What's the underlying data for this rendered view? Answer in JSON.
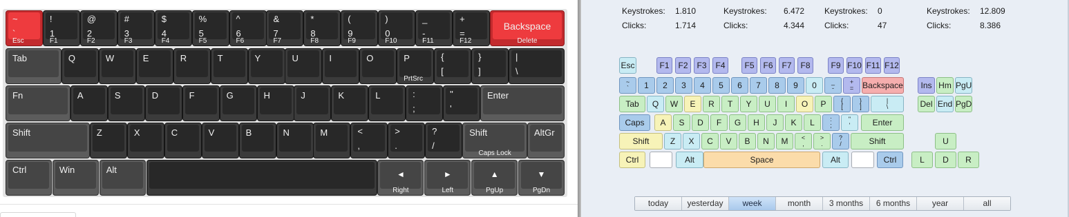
{
  "keyboard": {
    "keys": [
      {
        "id": "esc",
        "shape": "red",
        "top": "~",
        "bottom": "`",
        "fn": "Esc"
      },
      {
        "id": "1",
        "top": "!",
        "bottom": "1",
        "fn": "F1"
      },
      {
        "id": "2",
        "top": "@",
        "bottom": "2",
        "fn": "F2"
      },
      {
        "id": "3",
        "top": "#",
        "bottom": "3",
        "fn": "F3"
      },
      {
        "id": "4",
        "top": "$",
        "bottom": "4",
        "fn": "F4"
      },
      {
        "id": "5",
        "top": "%",
        "bottom": "5",
        "fn": "F5"
      },
      {
        "id": "6",
        "top": "^",
        "bottom": "6",
        "fn": "F6"
      },
      {
        "id": "7",
        "top": "&",
        "bottom": "7",
        "fn": "F7"
      },
      {
        "id": "8",
        "top": "*",
        "bottom": "8",
        "fn": "F8"
      },
      {
        "id": "9",
        "top": "(",
        "bottom": "9",
        "fn": "F9"
      },
      {
        "id": "0",
        "top": ")",
        "bottom": "0",
        "fn": "F10"
      },
      {
        "id": "minus",
        "top": "_",
        "bottom": "-",
        "fn": "F11"
      },
      {
        "id": "equals",
        "top": "+",
        "bottom": "=",
        "fn": "F12"
      },
      {
        "id": "backspace",
        "shape": "red",
        "center": "Backspace",
        "fn": "Delete"
      },
      {
        "id": "tab",
        "shape": "gray",
        "mid": "Tab"
      },
      {
        "id": "q",
        "mid": "Q"
      },
      {
        "id": "w",
        "mid": "W"
      },
      {
        "id": "e",
        "mid": "E"
      },
      {
        "id": "r",
        "mid": "R"
      },
      {
        "id": "t",
        "mid": "T"
      },
      {
        "id": "y",
        "mid": "Y"
      },
      {
        "id": "u",
        "mid": "U"
      },
      {
        "id": "i",
        "mid": "I"
      },
      {
        "id": "o",
        "mid": "O"
      },
      {
        "id": "p",
        "mid": "P",
        "fn": "PrtSrc"
      },
      {
        "id": "lbracket",
        "top": "{",
        "bottom": "["
      },
      {
        "id": "rbracket",
        "top": "}",
        "bottom": "]"
      },
      {
        "id": "backslash",
        "top": "|",
        "bottom": "\\"
      },
      {
        "id": "fn",
        "shape": "gray",
        "mid": "Fn"
      },
      {
        "id": "a",
        "mid": "A"
      },
      {
        "id": "s",
        "mid": "S"
      },
      {
        "id": "d",
        "mid": "D"
      },
      {
        "id": "f",
        "mid": "F"
      },
      {
        "id": "g",
        "mid": "G"
      },
      {
        "id": "h",
        "mid": "H"
      },
      {
        "id": "j",
        "mid": "J"
      },
      {
        "id": "k",
        "mid": "K"
      },
      {
        "id": "l",
        "mid": "L"
      },
      {
        "id": "semicolon",
        "top": ":",
        "bottom": ";"
      },
      {
        "id": "quote",
        "top": "\"",
        "bottom": "'"
      },
      {
        "id": "enter",
        "shape": "gray",
        "mid": "Enter"
      },
      {
        "id": "lshift",
        "shape": "gray",
        "mid": "Shift"
      },
      {
        "id": "z",
        "mid": "Z"
      },
      {
        "id": "x",
        "mid": "X"
      },
      {
        "id": "c",
        "mid": "C"
      },
      {
        "id": "v",
        "mid": "V"
      },
      {
        "id": "b",
        "mid": "B"
      },
      {
        "id": "n",
        "mid": "N"
      },
      {
        "id": "m",
        "mid": "M"
      },
      {
        "id": "comma",
        "top": "<",
        "bottom": ","
      },
      {
        "id": "period",
        "top": ">",
        "bottom": "."
      },
      {
        "id": "slash",
        "top": "?",
        "bottom": "/"
      },
      {
        "id": "rshift",
        "shape": "gray",
        "mid": "Shift",
        "fn": "Caps Lock"
      },
      {
        "id": "altgr",
        "shape": "gray",
        "mid": "AltGr"
      },
      {
        "id": "ctrl",
        "shape": "gray",
        "mid": "Ctrl"
      },
      {
        "id": "win",
        "shape": "gray",
        "mid": "Win"
      },
      {
        "id": "alt",
        "shape": "gray",
        "mid": "Alt"
      },
      {
        "id": "space"
      },
      {
        "id": "arrow-left",
        "shape": "gray",
        "arrow": "◄",
        "fn": "Right"
      },
      {
        "id": "arrow-right",
        "shape": "gray",
        "arrow": "►",
        "fn": "Left"
      },
      {
        "id": "arrow-up",
        "shape": "gray",
        "arrow": "▲",
        "fn": "PgUp"
      },
      {
        "id": "arrow-down",
        "shape": "gray",
        "arrow": "▼",
        "fn": "PgDn"
      }
    ]
  },
  "stats": [
    {
      "keystrokes_label": "Keystrokes:",
      "keystrokes": "1.810",
      "clicks_label": "Clicks:",
      "clicks": "1.714"
    },
    {
      "keystrokes_label": "Keystrokes:",
      "keystrokes": "6.472",
      "clicks_label": "Clicks:",
      "clicks": "4.344"
    },
    {
      "keystrokes_label": "Keystrokes:",
      "keystrokes": "0",
      "clicks_label": "Clicks:",
      "clicks": "47"
    },
    {
      "keystrokes_label": "Keystrokes:",
      "keystrokes": "12.809",
      "clicks_label": "Clicks:",
      "clicks": "8.386"
    }
  ],
  "heatmap": {
    "keys": [
      {
        "id": "esc",
        "label": "Esc",
        "color": "cyan"
      },
      {
        "id": "f1",
        "label": "F1",
        "color": "purple"
      },
      {
        "id": "f2",
        "label": "F2",
        "color": "purple"
      },
      {
        "id": "f3",
        "label": "F3",
        "color": "purple"
      },
      {
        "id": "f4",
        "label": "F4",
        "color": "purple"
      },
      {
        "id": "f5",
        "label": "F5",
        "color": "purple"
      },
      {
        "id": "f6",
        "label": "F6",
        "color": "purple"
      },
      {
        "id": "f7",
        "label": "F7",
        "color": "purple"
      },
      {
        "id": "f8",
        "label": "F8",
        "color": "purple"
      },
      {
        "id": "f9",
        "label": "F9",
        "color": "purple"
      },
      {
        "id": "f10",
        "label": "F10",
        "color": "purple"
      },
      {
        "id": "f11",
        "label": "F11",
        "color": "purple"
      },
      {
        "id": "f12",
        "label": "F12",
        "color": "purple"
      },
      {
        "id": "tilde",
        "label": "",
        "sub_top": "~",
        "sub_bottom": "`",
        "color": "blue"
      },
      {
        "id": "1",
        "label": "1",
        "color": "blue"
      },
      {
        "id": "2",
        "label": "2",
        "color": "blue"
      },
      {
        "id": "3",
        "label": "3",
        "color": "blue"
      },
      {
        "id": "4",
        "label": "4",
        "color": "blue"
      },
      {
        "id": "5",
        "label": "5",
        "color": "blue"
      },
      {
        "id": "6",
        "label": "6",
        "color": "blue"
      },
      {
        "id": "7",
        "label": "7",
        "color": "blue"
      },
      {
        "id": "8",
        "label": "8",
        "color": "blue"
      },
      {
        "id": "9",
        "label": "9",
        "color": "blue"
      },
      {
        "id": "0",
        "label": "0",
        "color": "cyan"
      },
      {
        "id": "minus",
        "label": "",
        "sub_top": "_",
        "sub_bottom": "-",
        "color": "blue"
      },
      {
        "id": "equals",
        "label": "",
        "sub_top": "+",
        "sub_bottom": "=",
        "color": "purple"
      },
      {
        "id": "backspace",
        "label": "Backspace",
        "color": "red"
      },
      {
        "id": "ins",
        "label": "Ins",
        "color": "purple"
      },
      {
        "id": "hm",
        "label": "Hm",
        "color": "green"
      },
      {
        "id": "pgu",
        "label": "PgU",
        "color": "cyan"
      },
      {
        "id": "tab",
        "label": "Tab",
        "color": "green"
      },
      {
        "id": "q",
        "label": "Q",
        "color": "cyan"
      },
      {
        "id": "w",
        "label": "W",
        "color": "green"
      },
      {
        "id": "e",
        "label": "E",
        "color": "yellow"
      },
      {
        "id": "r",
        "label": "R",
        "color": "green"
      },
      {
        "id": "t",
        "label": "T",
        "color": "green"
      },
      {
        "id": "y",
        "label": "Y",
        "color": "green"
      },
      {
        "id": "u",
        "label": "U",
        "color": "green"
      },
      {
        "id": "i",
        "label": "I",
        "color": "green"
      },
      {
        "id": "o",
        "label": "O",
        "color": "yellow"
      },
      {
        "id": "p",
        "label": "P",
        "color": "green"
      },
      {
        "id": "lbracket",
        "label": "",
        "sub_top": "{",
        "sub_bottom": "[",
        "color": "blue"
      },
      {
        "id": "rbracket",
        "label": "",
        "sub_top": "}",
        "sub_bottom": "]",
        "color": "blue"
      },
      {
        "id": "backslash",
        "label": "",
        "sub_top": "|",
        "sub_bottom": "\\",
        "color": "cyan"
      },
      {
        "id": "del",
        "label": "Del",
        "color": "green"
      },
      {
        "id": "end",
        "label": "End",
        "color": "cyan"
      },
      {
        "id": "pgd",
        "label": "PgD",
        "color": "green"
      },
      {
        "id": "caps",
        "label": "Caps",
        "color": "blue"
      },
      {
        "id": "a",
        "label": "A",
        "color": "yellow"
      },
      {
        "id": "s",
        "label": "S",
        "color": "green"
      },
      {
        "id": "d",
        "label": "D",
        "color": "green"
      },
      {
        "id": "f",
        "label": "F",
        "color": "green"
      },
      {
        "id": "g",
        "label": "G",
        "color": "green"
      },
      {
        "id": "h",
        "label": "H",
        "color": "green"
      },
      {
        "id": "j",
        "label": "J",
        "color": "green"
      },
      {
        "id": "k",
        "label": "K",
        "color": "green"
      },
      {
        "id": "l",
        "label": "L",
        "color": "green"
      },
      {
        "id": "semicolon",
        "label": "",
        "sub_top": ":",
        "sub_bottom": ";",
        "color": "blue"
      },
      {
        "id": "quote",
        "label": "",
        "sub_top": "\"",
        "sub_bottom": "'",
        "color": "cyan"
      },
      {
        "id": "enter",
        "label": "Enter",
        "color": "green"
      },
      {
        "id": "lshift",
        "label": "Shift",
        "color": "yellow"
      },
      {
        "id": "z",
        "label": "Z",
        "color": "cyan"
      },
      {
        "id": "x",
        "label": "X",
        "color": "cyan"
      },
      {
        "id": "c",
        "label": "C",
        "color": "green"
      },
      {
        "id": "v",
        "label": "V",
        "color": "green"
      },
      {
        "id": "b",
        "label": "B",
        "color": "green"
      },
      {
        "id": "n",
        "label": "N",
        "color": "green"
      },
      {
        "id": "m",
        "label": "M",
        "color": "green"
      },
      {
        "id": "comma",
        "label": "",
        "sub_top": "<",
        "sub_bottom": ",",
        "color": "green"
      },
      {
        "id": "period",
        "label": "",
        "sub_top": ">",
        "sub_bottom": ".",
        "color": "green"
      },
      {
        "id": "slash",
        "label": "",
        "sub_top": "?",
        "sub_bottom": "/",
        "color": "blue"
      },
      {
        "id": "rshift",
        "label": "Shift",
        "color": "green"
      },
      {
        "id": "arrow-up",
        "label": "U",
        "color": "green"
      },
      {
        "id": "ctrl",
        "label": "Ctrl",
        "color": "yellow"
      },
      {
        "id": "win",
        "label": "",
        "color": "white"
      },
      {
        "id": "alt",
        "label": "Alt",
        "color": "cyan"
      },
      {
        "id": "space",
        "label": "Space",
        "color": "orange"
      },
      {
        "id": "altgr",
        "label": "Alt",
        "color": "cyan"
      },
      {
        "id": "menu",
        "label": "",
        "color": "white"
      },
      {
        "id": "rctrl",
        "label": "Ctrl",
        "color": "blue"
      },
      {
        "id": "arrow-left",
        "label": "L",
        "color": "green"
      },
      {
        "id": "arrow-down",
        "label": "D",
        "color": "green"
      },
      {
        "id": "arrow-right",
        "label": "R",
        "color": "green"
      }
    ]
  },
  "time_range": {
    "options": [
      "today",
      "yesterday",
      "week",
      "month",
      "3 months",
      "6 months",
      "year",
      "all"
    ],
    "selected": "week"
  },
  "colors": {
    "key_red": "#ee3b3e",
    "key_dark": "#282828",
    "key_gray": "#454545",
    "panel_bg": "#e9eef5",
    "selected_tab": "#a9c9ec"
  }
}
